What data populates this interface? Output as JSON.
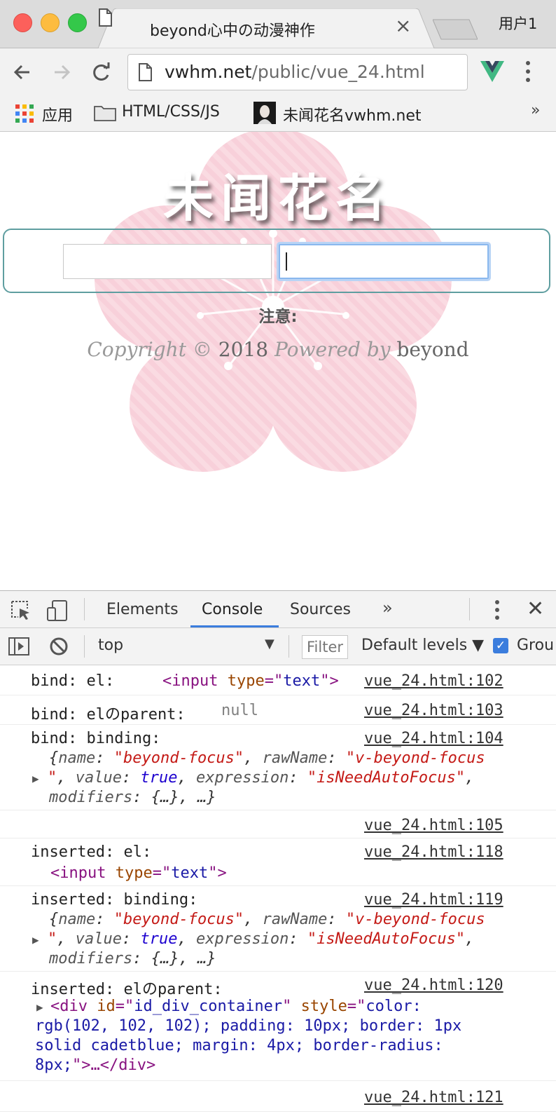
{
  "browser": {
    "tab_title": "beyond心中の动漫神作",
    "profile_label": "用户1",
    "url_host": "vwhm.net",
    "url_path": "/public/vue_24.html",
    "bookmarks": {
      "apps": "应用",
      "folder": "HTML/CSS/JS",
      "site": "未闻花名vwhm.net",
      "more": "»"
    }
  },
  "page": {
    "title": "未闻花名",
    "note": "注意:",
    "copyright_prefix": "Copyright ©",
    "copyright_year": "2018",
    "copyright_powered": "Powered by",
    "copyright_author": "beyond"
  },
  "devtools": {
    "tabs": [
      "Elements",
      "Console",
      "Sources"
    ],
    "active_tab": "Console",
    "more": "»",
    "context": "top",
    "filter_placeholder": "Filter",
    "levels": "Default levels ▼",
    "group_label": "Grou",
    "logs": [
      {
        "src": "vue_24.html:102",
        "label": "bind: el:"
      },
      {
        "src": "vue_24.html:103",
        "label": "bind: elのparent:",
        "value": "null"
      },
      {
        "src": "vue_24.html:104",
        "label": "bind: binding:"
      },
      {
        "src": "vue_24.html:105"
      },
      {
        "src": "vue_24.html:118",
        "label": "inserted: el:"
      },
      {
        "src": "vue_24.html:119",
        "label": "inserted: binding:"
      },
      {
        "src": "vue_24.html:120",
        "label": "inserted: elのparent:"
      },
      {
        "src": "vue_24.html:121"
      }
    ],
    "binding_obj": {
      "name_key": "name",
      "name_val": "\"beyond-focus\"",
      "raw_key": "rawName",
      "raw_val": "\"v-beyond-focus",
      "raw_val_end": "\"",
      "value_key": "value",
      "value_val": "true",
      "expr_key": "expression",
      "expr_val": "\"isNeedAutoFocus\"",
      "mod_key": "modifiers",
      "mod_val": "{…}, …}"
    },
    "input_tag": {
      "tag": "input",
      "attr": "type",
      "val": "text"
    },
    "div_tag": {
      "tag": "div",
      "id_attr": "id",
      "id_val": "id_div_container",
      "style_attr": "style",
      "style_line1": "color:",
      "style_line2": "rgb(102, 102, 102); padding: 10px; border: 1px",
      "style_line3": "solid cadetblue; margin: 4px; border-radius:",
      "style_line4": "8px;",
      "ellipsis": ">…</",
      "close": "div>"
    }
  }
}
